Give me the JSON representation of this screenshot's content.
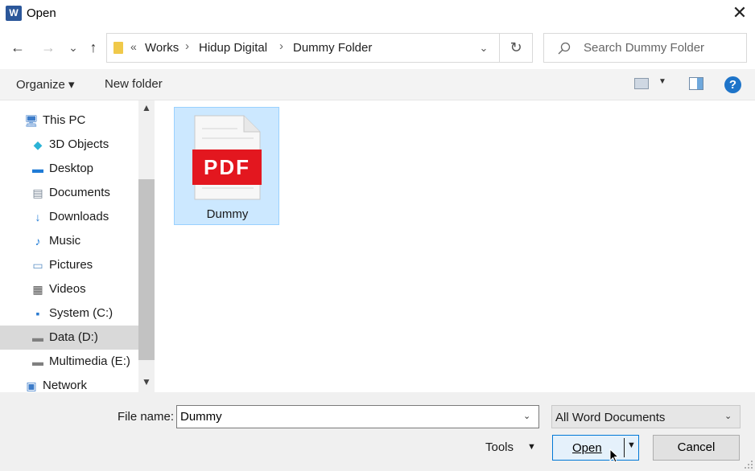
{
  "window": {
    "title": "Open",
    "app_icon_letter": "W"
  },
  "nav_buttons": {
    "back": "←",
    "forward": "→",
    "recent": "⌄",
    "up": "↑"
  },
  "address": {
    "overflow": "«",
    "crumbs": [
      "Works",
      "Hidup Digital",
      "Dummy Folder"
    ],
    "separator": "›"
  },
  "search": {
    "placeholder": "Search Dummy Folder"
  },
  "toolbar": {
    "organize_label": "Organize ▾",
    "new_folder_label": "New folder",
    "help_label": "?"
  },
  "nav_pane": {
    "items": [
      {
        "label": "This PC",
        "icon": "pc-icon",
        "glyph": "🖥",
        "color": "#3d7cc9"
      },
      {
        "label": "3D Objects",
        "icon": "cube-icon",
        "glyph": "◆",
        "color": "#2bb3d6"
      },
      {
        "label": "Desktop",
        "icon": "desktop-icon",
        "glyph": "▬",
        "color": "#1f7bd6"
      },
      {
        "label": "Documents",
        "icon": "documents-icon",
        "glyph": "▤",
        "color": "#7a8796"
      },
      {
        "label": "Downloads",
        "icon": "downloads-icon",
        "glyph": "↓",
        "color": "#1f7bd6"
      },
      {
        "label": "Music",
        "icon": "music-icon",
        "glyph": "♪",
        "color": "#1f7bd6"
      },
      {
        "label": "Pictures",
        "icon": "pictures-icon",
        "glyph": "▭",
        "color": "#5a8fc4"
      },
      {
        "label": "Videos",
        "icon": "videos-icon",
        "glyph": "▦",
        "color": "#555555"
      },
      {
        "label": "System (C:)",
        "icon": "drive-windows-icon",
        "glyph": "▪",
        "color": "#2a7ad0"
      },
      {
        "label": "Data (D:)",
        "icon": "drive-icon",
        "glyph": "▬",
        "color": "#808080"
      },
      {
        "label": "Multimedia (E:)",
        "icon": "drive-icon",
        "glyph": "▬",
        "color": "#808080"
      },
      {
        "label": "Network",
        "icon": "network-icon",
        "glyph": "▣",
        "color": "#3d7cc9"
      }
    ],
    "selected": "Data (D:)"
  },
  "files": [
    {
      "name": "Dummy",
      "type": "PDF",
      "badge": "PDF",
      "badge_color": "#e3171f"
    }
  ],
  "bottom": {
    "file_name_label": "File name:",
    "file_name_value": "Dummy",
    "filter_value": "All Word Documents",
    "tools_label": "Tools",
    "open_label": "Open",
    "cancel_label": "Cancel"
  }
}
